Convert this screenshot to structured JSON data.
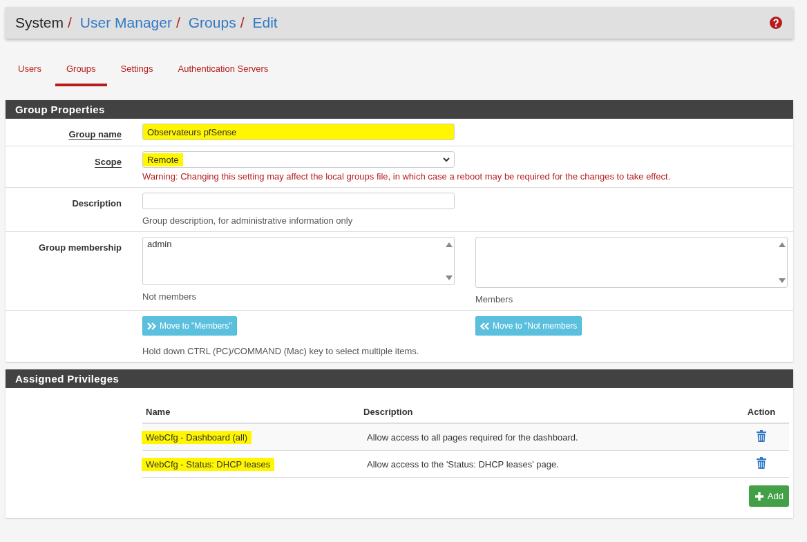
{
  "breadcrumb": [
    {
      "label": "System",
      "link": false,
      "separator": "/"
    },
    {
      "label": "User Manager",
      "link": true,
      "separator": "/"
    },
    {
      "label": "Groups",
      "link": true,
      "separator": "/"
    },
    {
      "label": "Edit",
      "link": true
    }
  ],
  "tabs": [
    {
      "label": "Users",
      "selected": false
    },
    {
      "label": "Groups",
      "selected": true
    },
    {
      "label": "Settings",
      "selected": false
    },
    {
      "label": "Authentication Servers",
      "selected": false
    }
  ],
  "group_properties": {
    "title": "Group Properties",
    "group_name": {
      "label": "Group name",
      "value": "Observateurs pfSense",
      "highlighted": true
    },
    "scope": {
      "label": "Scope",
      "value": "Remote",
      "highlighted": true,
      "warning": "Warning: Changing this setting may affect the local groups file, in which case a reboot may be required for the changes to take effect."
    },
    "description": {
      "label": "Description",
      "help": "Group description, for administrative information only"
    },
    "membership": {
      "label": "Group membership",
      "not_members": [
        "admin"
      ],
      "not_members_label": "Not members",
      "members_label": "Members"
    },
    "buttons": [
      {
        "label": "Move to \"Members\"",
        "kind": "right"
      },
      {
        "label": "Move to \"Not members",
        "kind": "left"
      }
    ],
    "hint": "Hold down CTRL (PC)/COMMAND (Mac) key to select multiple items."
  },
  "assigned_privileges": {
    "title": "Assigned Privileges",
    "columns": [
      "Name",
      "Description",
      "Action"
    ],
    "rows": [
      {
        "name": "WebCfg - Dashboard (all)",
        "description": "Allow access to all pages required for the dashboard.",
        "highlighted": true
      },
      {
        "name": "WebCfg - Status: DHCP leases",
        "description": "Allow access to the 'Status: DHCP leases' page.",
        "highlighted": true
      }
    ],
    "add_button": "Add"
  }
}
